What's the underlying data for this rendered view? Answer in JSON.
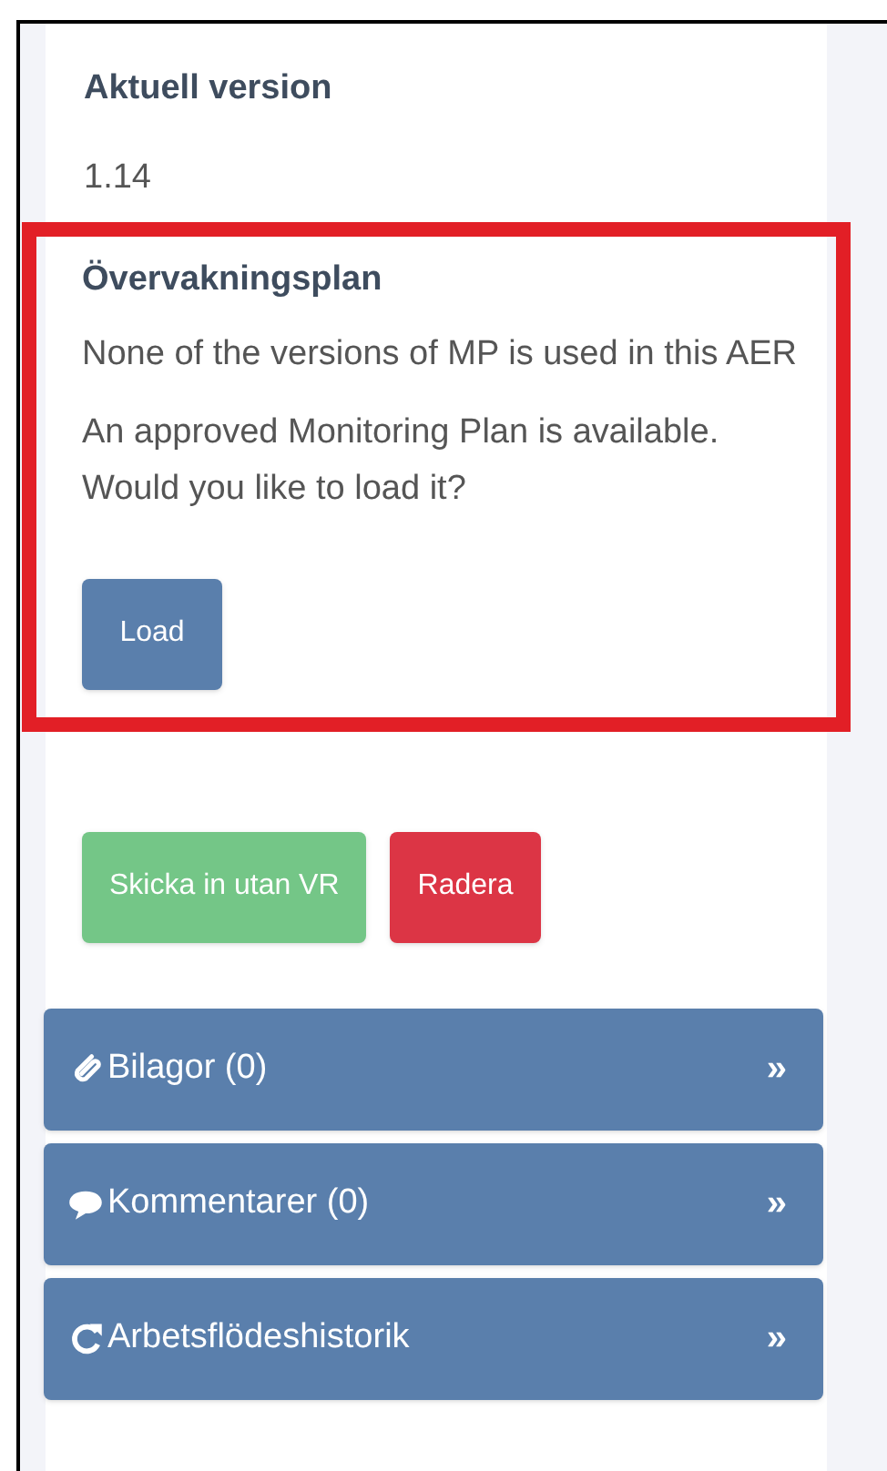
{
  "current_version": {
    "label": "Aktuell version",
    "value": "1.14"
  },
  "monitoring_plan": {
    "title": "Övervakningsplan",
    "messages": [
      "None of the versions of MP is used in this AER",
      "An approved Monitoring Plan is available. Would you like to load it?"
    ],
    "button": "Load"
  },
  "actions": [
    {
      "label": "Skicka in utan VR",
      "kind": "success"
    },
    {
      "label": "Radera",
      "kind": "danger"
    }
  ],
  "panels": [
    {
      "label": "Bilagor (0)",
      "kind": "attachments",
      "chevron": "»"
    },
    {
      "label": "Kommentarer (0)",
      "kind": "comments",
      "chevron": "»"
    },
    {
      "label": "Arbetsflödeshistorik",
      "kind": "history",
      "chevron": "»"
    }
  ]
}
